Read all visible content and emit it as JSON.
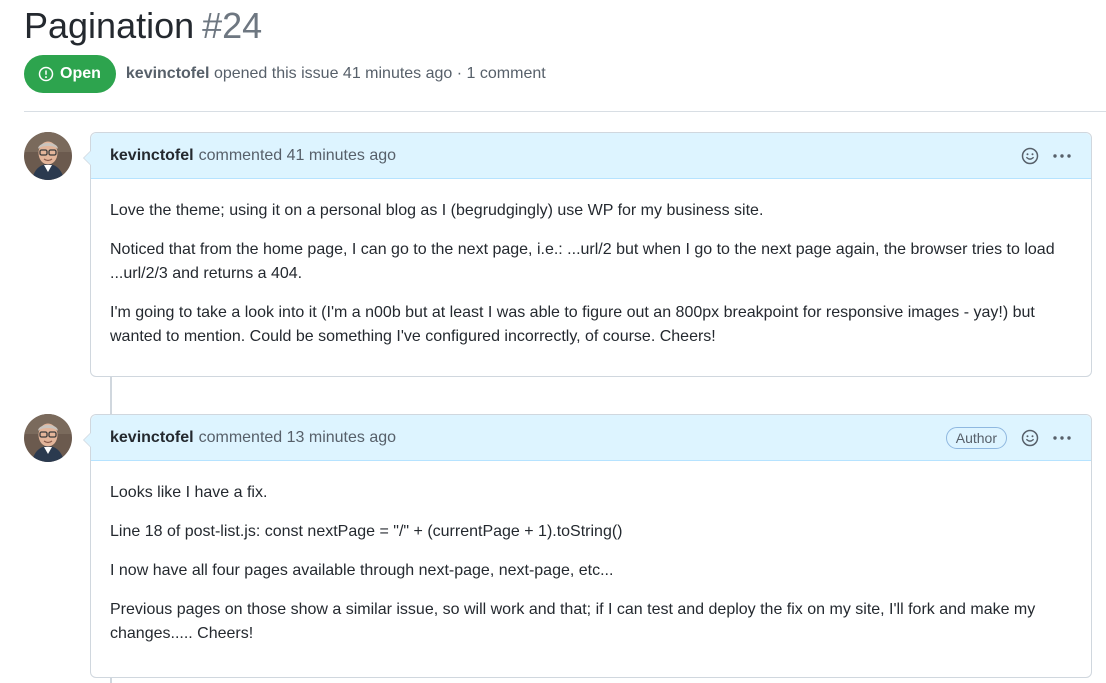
{
  "issue": {
    "title": "Pagination",
    "number": "#24",
    "state": "Open",
    "author": "kevinctofel",
    "meta_text": "opened this issue 41 minutes ago · 1 comment"
  },
  "comments": [
    {
      "author": "kevinctofel",
      "action": "commented 41 minutes ago",
      "badge": "",
      "body": [
        "Love the theme; using it on a personal blog as I (begrudgingly) use WP for my business site.",
        "Noticed that from the home page, I can go to the next page, i.e.: ...url/2 but when I go to the next page again, the browser tries to load ...url/2/3 and returns a 404.",
        "I'm going to take a look into it (I'm a n00b but at least I was able to figure out an 800px breakpoint for responsive images - yay!) but wanted to mention. Could be something I've configured incorrectly, of course. Cheers!"
      ]
    },
    {
      "author": "kevinctofel",
      "action": "commented 13 minutes ago",
      "badge": "Author",
      "body": [
        "Looks like I have a fix.",
        "Line 18 of post-list.js: const nextPage = \"/\" + (currentPage + 1).toString()",
        "I now have all four pages available through next-page, next-page, etc...",
        "Previous pages on those show a similar issue, so will work and that; if I can test and deploy the fix on my site, I'll fork and make my changes..... Cheers!"
      ]
    }
  ],
  "icons": {
    "state": "issue-opened-icon",
    "reaction": "smiley-icon",
    "menu": "kebab-horizontal-icon"
  },
  "colors": {
    "open_green": "#2da44e",
    "comment_header_bg": "#ddf4ff",
    "border": "#d0d7de"
  }
}
